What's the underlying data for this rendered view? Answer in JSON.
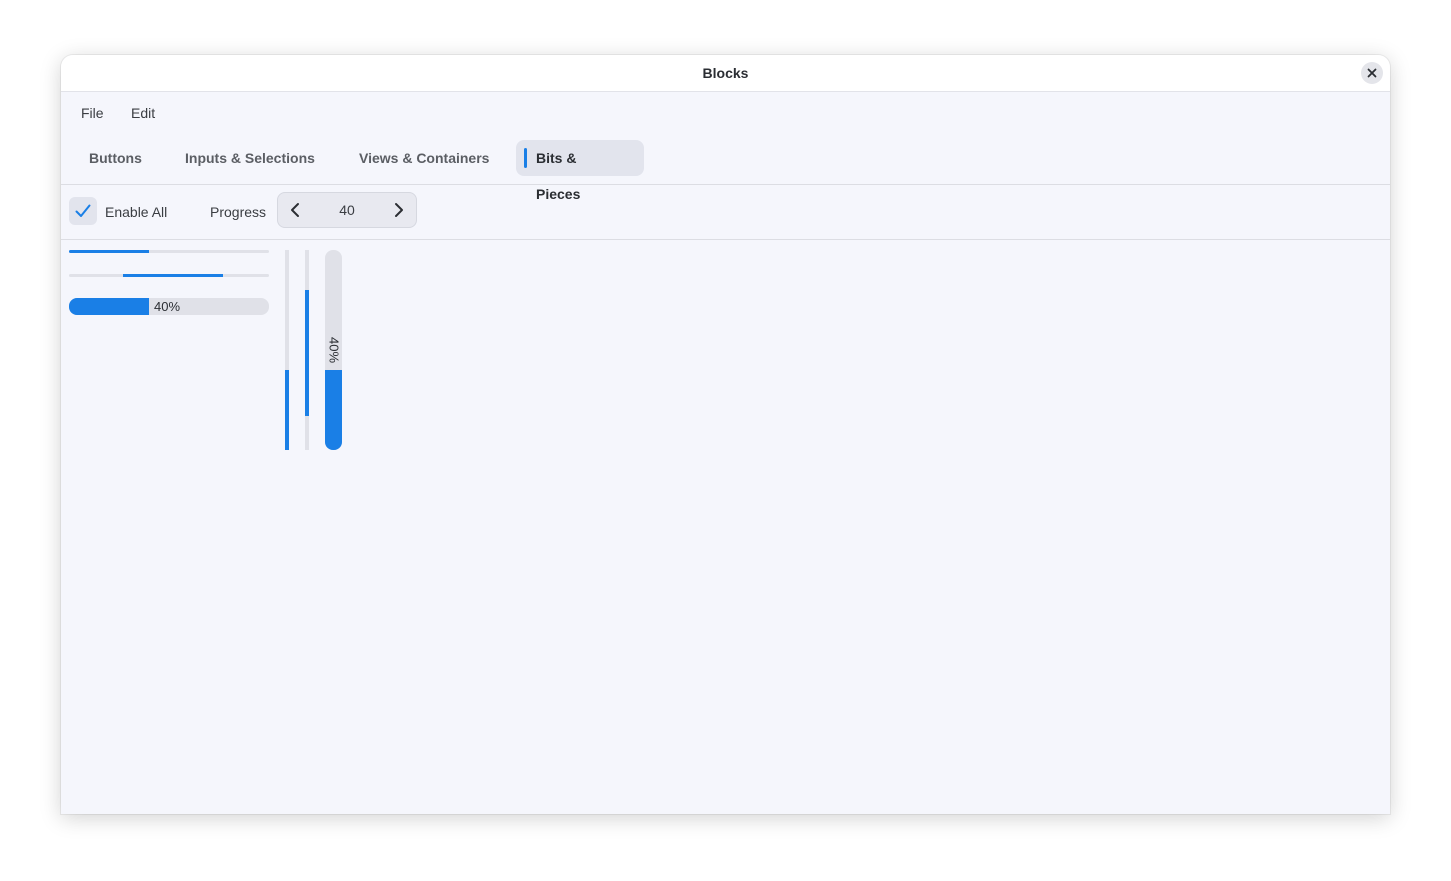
{
  "window": {
    "title": "Blocks",
    "close_icon": "close-icon"
  },
  "menubar": {
    "items": [
      "File",
      "Edit"
    ]
  },
  "tabs": [
    {
      "label": "Buttons",
      "active": false
    },
    {
      "label": "Inputs & Selections",
      "active": false
    },
    {
      "label": "Views & Containers",
      "active": false
    },
    {
      "label": "Bits & Pieces",
      "active": true
    }
  ],
  "toolbar": {
    "enable_all": {
      "label": "Enable All",
      "checked": true,
      "icon": "checkmark-icon"
    },
    "progress": {
      "label": "Progress",
      "value": "40",
      "decrement_icon": "chevron-left-icon",
      "increment_icon": "chevron-right-icon"
    }
  },
  "progress_bars": {
    "horizontal_plain": {
      "value": 0.4
    },
    "horizontal_indeterminate": {
      "start": 0.27,
      "end": 0.77
    },
    "horizontal_with_text": {
      "value": 0.4,
      "text": "40%"
    },
    "vertical_plain": {
      "value": 0.4
    },
    "vertical_indeterminate": {
      "start": 0.2,
      "end": 0.83
    },
    "vertical_with_text": {
      "value": 0.4,
      "text": "40%"
    }
  },
  "colors": {
    "accent": "#1a7fe6",
    "track": "#e0e1e8",
    "window_bg": "#f5f6fc"
  }
}
